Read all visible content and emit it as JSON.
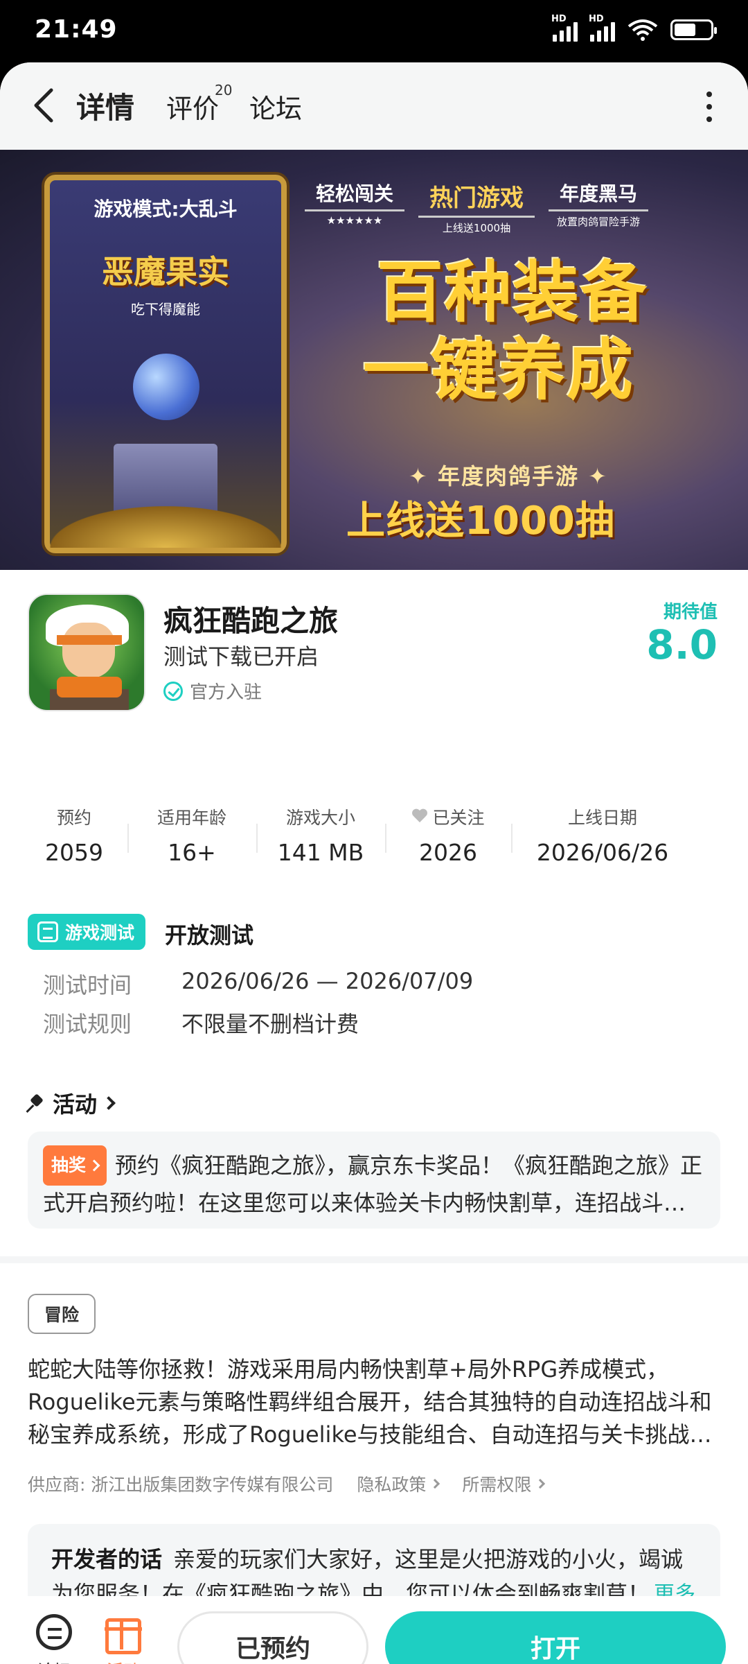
{
  "status_bar": {
    "time": "21:49",
    "battery_level": 0.6
  },
  "nav": {
    "tabs": [
      {
        "label": "详情",
        "active": true
      },
      {
        "label": "评价",
        "badge": "20"
      },
      {
        "label": "论坛"
      }
    ]
  },
  "banner": {
    "card_mode": "游戏模式:大乱斗",
    "card_title": "恶魔果实",
    "card_sub": "吃下得魔能",
    "badges": [
      {
        "title": "轻松闯关",
        "sub": "★★★★★★"
      },
      {
        "title": "热门游戏",
        "sub": "上线送1000抽"
      },
      {
        "title": "年度黑马",
        "sub": "放置肉鸽冒险手游"
      }
    ],
    "slogan_line1": "百种装备",
    "slogan_line2": "一键养成",
    "subtitle": "✦ 年度肉鸽手游 ✦",
    "gift_text": "上线送1000抽"
  },
  "app": {
    "name": "疯狂酷跑之旅",
    "status": "测试下载已开启",
    "official": "官方入驻",
    "expect_label": "期待值",
    "expect_value": "8.0"
  },
  "stats": [
    {
      "label": "预约",
      "value": "2059"
    },
    {
      "label": "适用年龄",
      "value": "16+"
    },
    {
      "label": "游戏大小",
      "value": "141 MB"
    },
    {
      "label": "已关注",
      "value": "2026"
    },
    {
      "label": "上线日期",
      "value": "2026/06/26"
    }
  ],
  "test": {
    "tag": "游戏测试",
    "title": "开放测试",
    "time_label": "测试时间",
    "time_value": "2026/06/26 — 2026/07/09",
    "rule_label": "测试规则",
    "rule_value": "不限量不删档计费"
  },
  "activity": {
    "heading": "活动",
    "tag": "抽奖",
    "text": "预约《疯狂酷跑之旅》，赢京东卡奖品！《疯狂酷跑之旅》正式开启预约啦！在这里您可以来体验关卡内畅快割草，连招战斗和..."
  },
  "description": {
    "genre": "冒险",
    "text": "蛇蛇大陆等你拯救！游戏采用局内畅快割草+局外RPG养成模式，Roguelike元素与策略性羁绊组合展开，结合其独特的自动连招战斗和秘宝养成系统，形成了Roguelike与技能组合、自动连招与关卡挑战的...",
    "supplier": "供应商: 浙江出版集团数字传媒有限公司",
    "privacy": "隐私政策",
    "permissions": "所需权限"
  },
  "developer": {
    "label": "开发者的话",
    "text": "亲爱的玩家们大家好，这里是火把游戏的小火，竭诚为您服务！在《疯狂酷跑之旅》中，您可以体会到畅爽割草！轻",
    "more": "更多"
  },
  "bottom_bar": {
    "forum": "论坛",
    "activity": "活动",
    "reserved": "已预约",
    "open": "打开"
  }
}
